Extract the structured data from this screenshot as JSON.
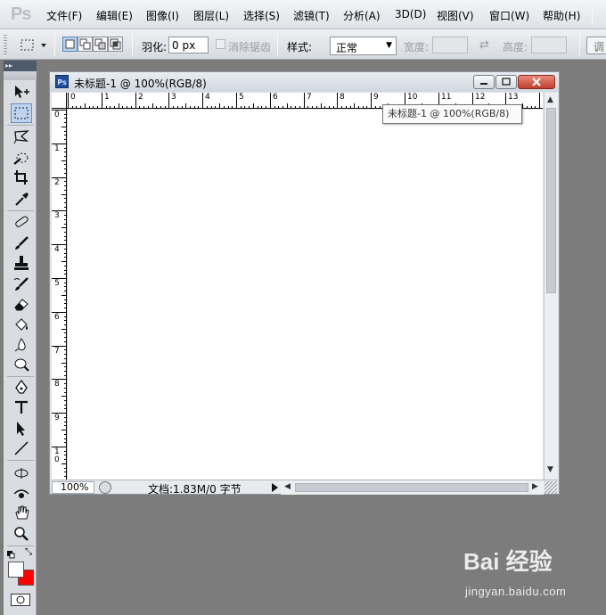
{
  "app": {
    "logo": "Ps",
    "menu": [
      "文件(F)",
      "编辑(E)",
      "图像(I)",
      "图层(L)",
      "选择(S)",
      "滤镜(T)",
      "分析(A)",
      "3D(D)",
      "视图(V)",
      "窗口(W)",
      "帮助(H)"
    ]
  },
  "options": {
    "feather_label": "羽化:",
    "feather_value": "0 px",
    "antialias_label": "消除锯齿",
    "style_label": "样式:",
    "style_value": "正常",
    "width_label": "宽度:",
    "height_label": "高度:",
    "adjust_label": "调"
  },
  "document": {
    "title": "未标题-1 @ 100%(RGB/8)",
    "tooltip": "未标题-1 @ 100%(RGB/8)",
    "ruler_h": [
      "0",
      "1",
      "2",
      "3",
      "4",
      "5",
      "6",
      "7",
      "8",
      "9",
      "10",
      "11",
      "12",
      "13",
      "1"
    ],
    "ruler_v": [
      "0",
      "1",
      "2",
      "3",
      "4",
      "5",
      "6",
      "7",
      "8",
      "9",
      "10"
    ],
    "zoom": "100%",
    "info": "文档:1.83M/0 字节"
  },
  "colors": {
    "foreground": "#ffffff",
    "background": "#ff0000"
  },
  "watermark": {
    "logo": "Bai 经验",
    "url": "jingyan.baidu.com"
  }
}
